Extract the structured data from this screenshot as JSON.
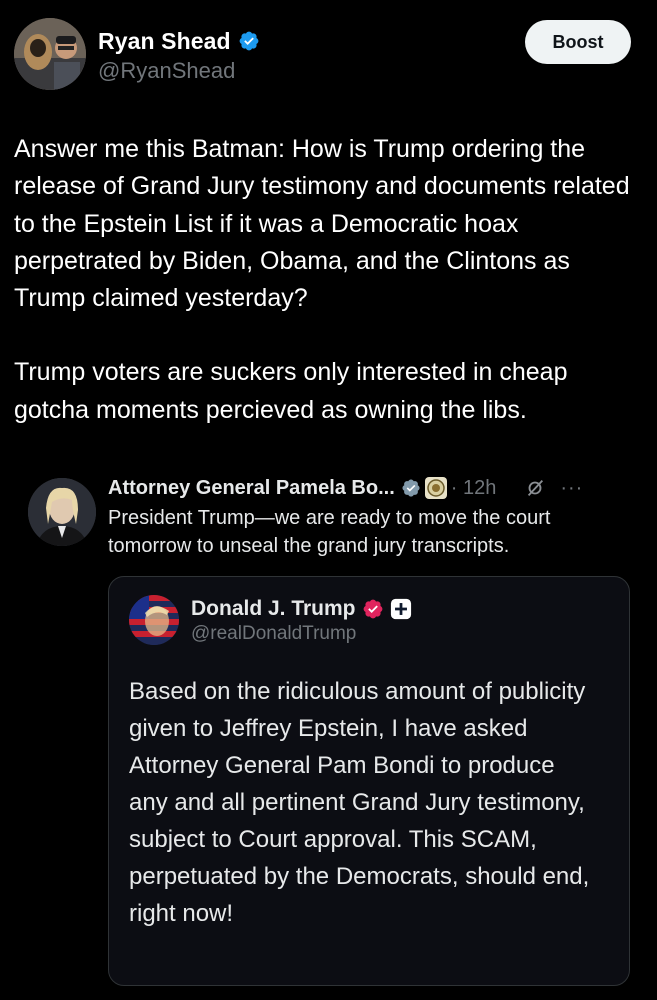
{
  "post": {
    "author": {
      "display_name": "Ryan Shead",
      "handle": "@RyanShead",
      "verified_color": "#1d9bf0"
    },
    "boost_label": "Boost",
    "paragraphs": [
      "Answer me this Batman: How is Trump ordering the release of Grand Jury testimony and documents related to the Epstein List if it was a Democratic hoax perpetrated by Biden, Obama, and the Clintons as Trump claimed yesterday?",
      "Trump voters are suckers only interested in cheap gotcha moments percieved as owning the libs."
    ]
  },
  "quoted": {
    "display_name": "Attorney General Pamela Bo...",
    "time": "· 12h",
    "more_label": "···",
    "text": "President Trump—we are ready to move the court tomorrow to unseal the grand jury transcripts."
  },
  "embedded": {
    "display_name": "Donald J. Trump",
    "handle": "@realDonaldTrump",
    "gov_badge_color": "#e0245e",
    "text": "Based on the ridiculous amount of publicity given to Jeffrey Epstein, I have asked Attorney General Pam Bondi to produce any and all pertinent Grand Jury testimony, subject to Court approval. This SCAM, perpetuated by the Democrats, should end, right now!"
  },
  "icons": {
    "verified": "verified-check-icon",
    "affiliation": "affiliation-seal-icon",
    "grok": "grok-icon",
    "more": "more-options-icon",
    "gov": "government-badge-icon",
    "plus": "plus-badge-icon"
  },
  "colors": {
    "background": "#000000",
    "text": "#ffffff",
    "muted": "#71767b",
    "border": "#2f3336",
    "accent": "#1d9bf0"
  }
}
